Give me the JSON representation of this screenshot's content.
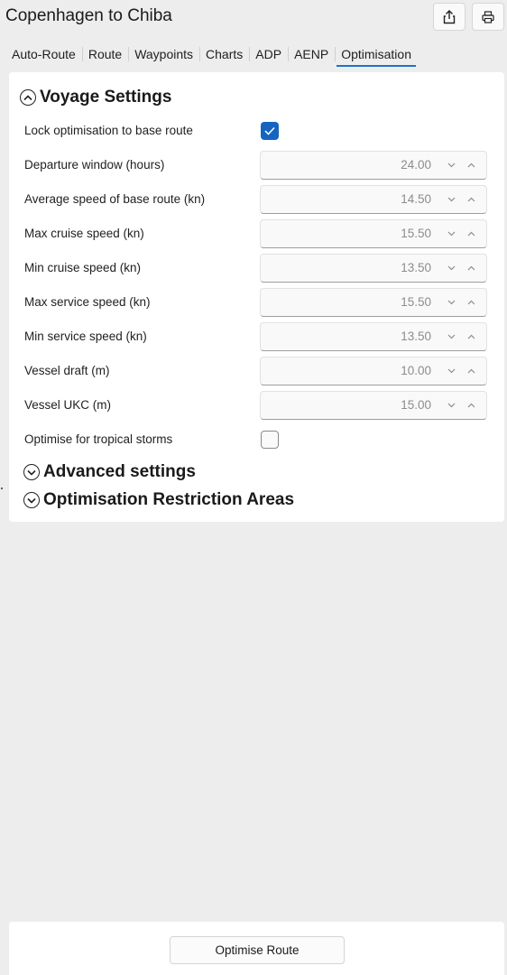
{
  "window": {
    "title": "Copenhagen to Chiba",
    "share_icon": "share-icon",
    "print_icon": "print-icon"
  },
  "tabs": [
    {
      "label": "Auto-Route",
      "active": false
    },
    {
      "label": "Route",
      "active": false
    },
    {
      "label": "Waypoints",
      "active": false
    },
    {
      "label": "Charts",
      "active": false
    },
    {
      "label": "ADP",
      "active": false
    },
    {
      "label": "AENP",
      "active": false
    },
    {
      "label": "Optimisation",
      "active": true
    }
  ],
  "voyage_settings": {
    "title": "Voyage Settings",
    "lock_optimisation": {
      "label": "Lock optimisation to base route",
      "checked": true
    },
    "fields": [
      {
        "label": "Departure window (hours)",
        "value": "24.00"
      },
      {
        "label": "Average speed of base route (kn)",
        "value": "14.50"
      },
      {
        "label": "Max cruise speed (kn)",
        "value": "15.50"
      },
      {
        "label": "Min cruise speed (kn)",
        "value": "13.50"
      },
      {
        "label": "Max service speed (kn)",
        "value": "15.50"
      },
      {
        "label": "Min service speed (kn)",
        "value": "13.50"
      },
      {
        "label": "Vessel draft (m)",
        "value": "10.00"
      },
      {
        "label": "Vessel UKC (m)",
        "value": "15.00"
      }
    ],
    "tropical_storms": {
      "label": "Optimise for tropical storms",
      "checked": false
    }
  },
  "advanced_settings": {
    "title": "Advanced settings"
  },
  "restriction_areas": {
    "title": "Optimisation Restriction Areas"
  },
  "footer": {
    "optimise_button": "Optimise Route"
  },
  "colors": {
    "accent": "#1565c0",
    "tab_underline": "#1a73c8"
  }
}
